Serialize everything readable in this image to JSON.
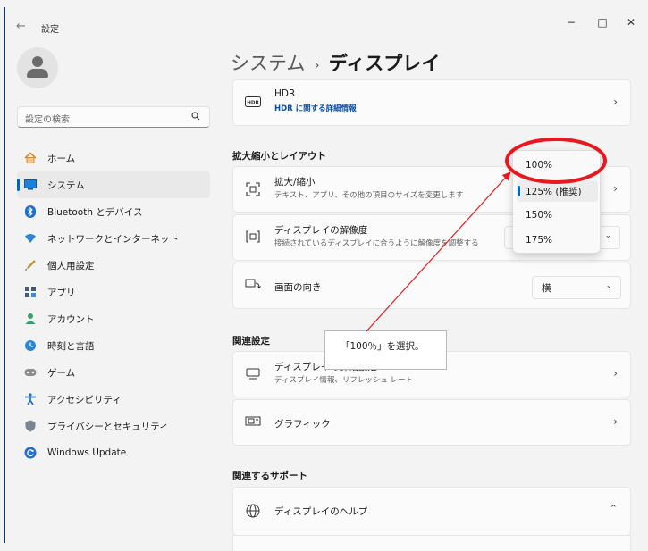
{
  "window": {
    "title": "設定",
    "back_glyph": "←",
    "minimize_glyph": "−",
    "maximize_glyph": "□",
    "close_glyph": "✕"
  },
  "search": {
    "placeholder": "設定の検索"
  },
  "sidebar": {
    "items": [
      {
        "label": "ホーム",
        "icon": "home-icon"
      },
      {
        "label": "システム",
        "icon": "system-icon",
        "active": true
      },
      {
        "label": "Bluetooth とデバイス",
        "icon": "bluetooth-icon"
      },
      {
        "label": "ネットワークとインターネット",
        "icon": "network-icon"
      },
      {
        "label": "個人用設定",
        "icon": "brush-icon"
      },
      {
        "label": "アプリ",
        "icon": "apps-icon"
      },
      {
        "label": "アカウント",
        "icon": "account-icon"
      },
      {
        "label": "時刻と言語",
        "icon": "clock-icon"
      },
      {
        "label": "ゲーム",
        "icon": "gamepad-icon"
      },
      {
        "label": "アクセシビリティ",
        "icon": "accessibility-icon"
      },
      {
        "label": "プライバシーとセキュリティ",
        "icon": "shield-icon"
      },
      {
        "label": "Windows Update",
        "icon": "update-icon"
      }
    ]
  },
  "breadcrumb": {
    "parent": "システム",
    "separator": "›",
    "current": "ディスプレイ"
  },
  "hdr_card": {
    "title": "HDR",
    "link": "HDR に関する詳細情報",
    "icon_text": "HDR"
  },
  "scale_section": {
    "label": "拡大縮小とレイアウト",
    "scale": {
      "title": "拡大/縮小",
      "subtitle": "テキスト、アプリ、その他の項目のサイズを変更します"
    },
    "resolution": {
      "title": "ディスプレイの解像度",
      "subtitle": "接続されているディスプレイに合うように解像度を調整する"
    },
    "orientation": {
      "title": "画面の向き",
      "value": "横"
    }
  },
  "scale_dropdown": {
    "options": [
      "100%",
      "125% (推奨)",
      "150%",
      "175%"
    ],
    "selected_index": 1
  },
  "related_settings": {
    "label": "関連設定",
    "advanced_display": {
      "title": "ディスプレイの詳細設定",
      "subtitle": "ディスプレイ情報、リフレッシュ レート"
    },
    "graphics": {
      "title": "グラフィック"
    }
  },
  "related_support": {
    "label": "関連するサポート",
    "help": {
      "title": "ディスプレイのヘルプ"
    }
  },
  "annotation": {
    "text": "「100％」を選択。",
    "highlight_color": "#e8191e",
    "arrow_color": "#e8191e"
  },
  "colors": {
    "accent": "#0067c0",
    "link": "#0b4fa8"
  }
}
